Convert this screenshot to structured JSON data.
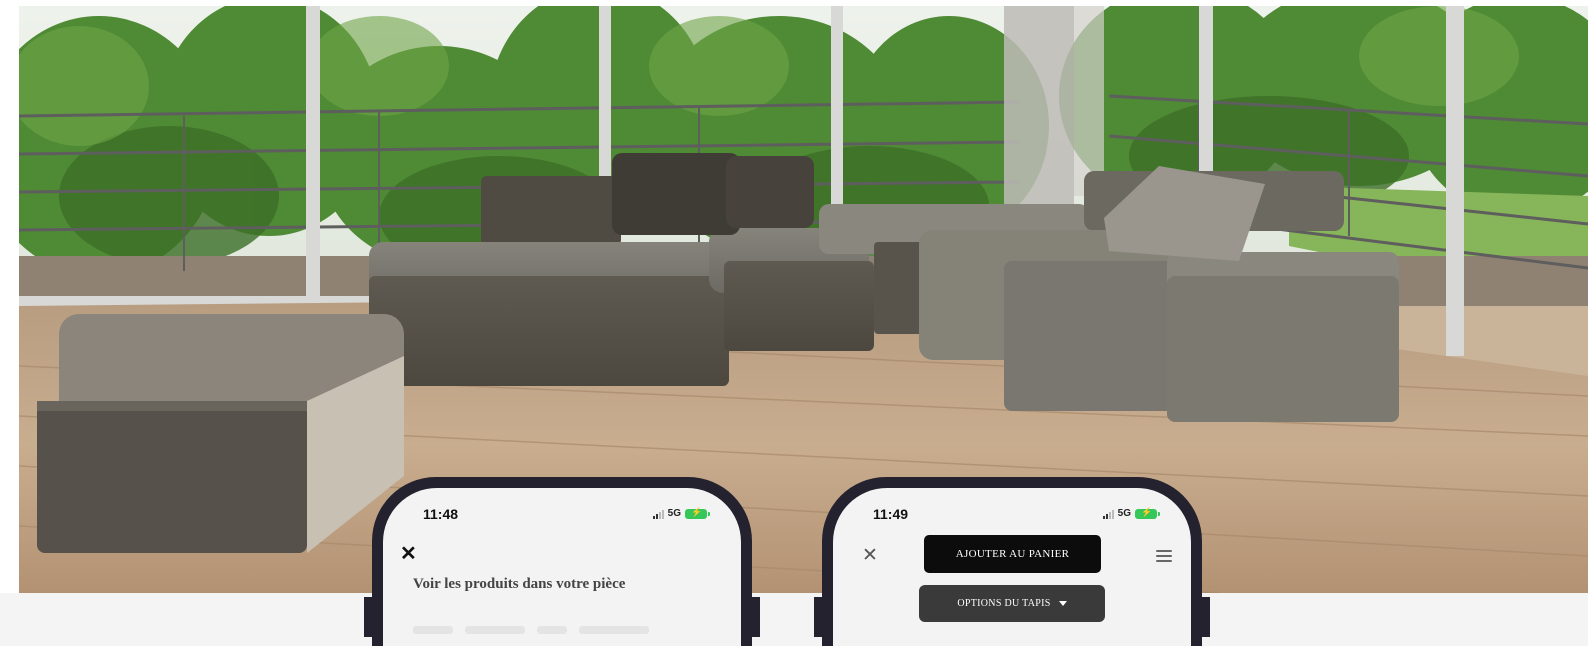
{
  "hero": {
    "image": "living-room-sectional-sofa"
  },
  "phones": [
    {
      "status": {
        "time": "11:48",
        "network": "5G"
      },
      "title": "Voir les produits dans votre pièce"
    },
    {
      "status": {
        "time": "11:49",
        "network": "5G"
      },
      "add_to_cart_label": "AJOUTER AU PANIER",
      "options_label": "OPTIONS DU TAPIS"
    }
  ],
  "colors": {
    "phone_frame": "#23222e",
    "screen_bg": "#f3f3f3",
    "primary_button": "#0c0c0c",
    "secondary_button": "#3a3a3a",
    "battery": "#35c759"
  },
  "icons": [
    "close-icon",
    "menu-icon",
    "chevron-down-icon",
    "signal-icon",
    "battery-icon"
  ]
}
